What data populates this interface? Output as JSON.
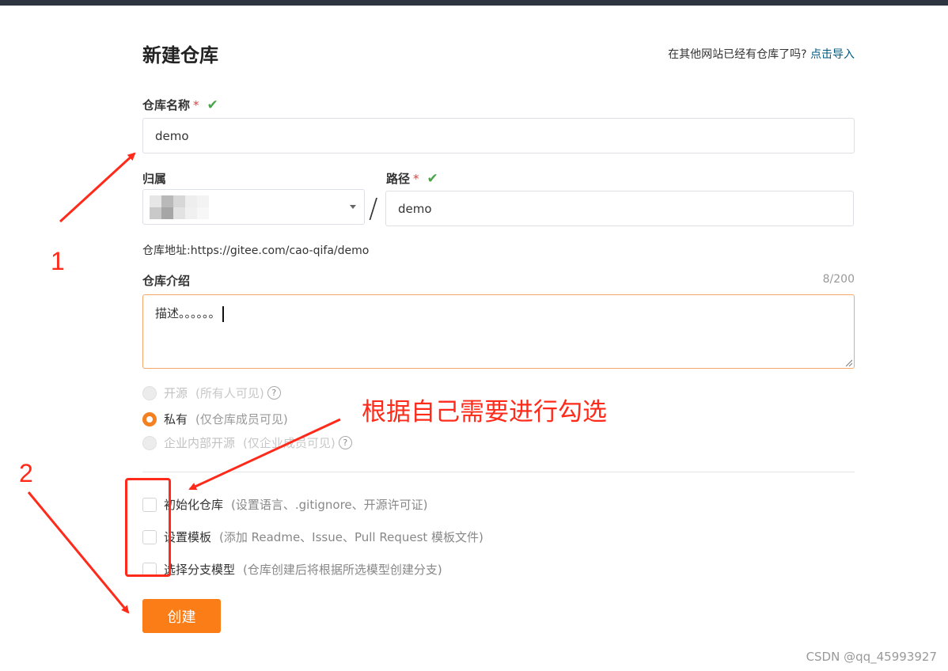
{
  "page": {
    "title": "新建仓库"
  },
  "import": {
    "prompt": "在其他网站已经有仓库了吗?",
    "link": "点击导入"
  },
  "repo_name": {
    "label": "仓库名称",
    "required_mark": "*",
    "value": "demo"
  },
  "owner": {
    "label": "归属",
    "separator": "/"
  },
  "path": {
    "label": "路径",
    "required_mark": "*",
    "value": "demo"
  },
  "repo_address": {
    "text": "仓库地址:https://gitee.com/cao-qifa/demo"
  },
  "description": {
    "label": "仓库介绍",
    "counter": "8/200",
    "value": "描述。。。。。。"
  },
  "visibility": {
    "options": [
      {
        "label": "开源",
        "note": "(所有人可见)",
        "state": "disabled"
      },
      {
        "label": "私有",
        "note": "(仅仓库成员可见)",
        "state": "selected"
      },
      {
        "label": "企业内部开源",
        "note": "(仅企业成员可见)",
        "state": "disabled"
      }
    ]
  },
  "options": {
    "items": [
      {
        "label": "初始化仓库",
        "note": "(设置语言、.gitignore、开源许可证)",
        "checked": false
      },
      {
        "label": "设置模板",
        "note": "(添加 Readme、Issue、Pull Request 模板文件)",
        "checked": false
      },
      {
        "label": "选择分支模型",
        "note": "(仓库创建后将根据所选模型创建分支)",
        "checked": false
      }
    ]
  },
  "create_button": {
    "label": "创建"
  },
  "annotations": {
    "marker1": "1",
    "marker2": "2",
    "note": "根据自己需要进行勾选"
  },
  "watermark": {
    "text": "CSDN @qq_45993927"
  },
  "colors": {
    "accent": "#fa7d18",
    "link": "#005980",
    "required": "#e63e3e",
    "valid": "#47a447",
    "annotation": "#ff2a1a"
  },
  "icons": {
    "valid": "check-icon",
    "help": "question-circle-icon",
    "dropdown": "caret-down-icon"
  }
}
